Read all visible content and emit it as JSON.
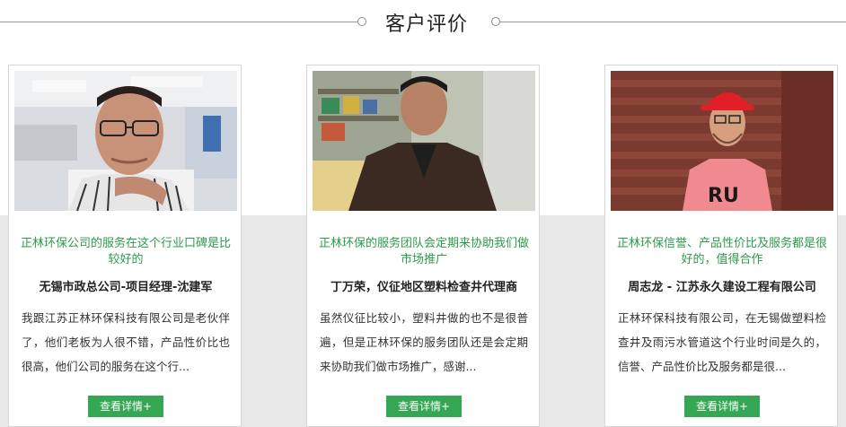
{
  "section": {
    "title": "客户评价"
  },
  "testimonials": [
    {
      "quote": "正林环保公司的服务在这个行业口碑是比较好的",
      "person": "无锡市政总公司-项目经理-沈建军",
      "body": "我跟江苏正林环保科技有限公司是老伙伴了，他们老板为人很不错，产品性价比也很高，他们公司的服务在这个行...",
      "button": "查看详情+",
      "photo": "portrait-man-glasses-office"
    },
    {
      "quote": "正林环保的服务团队会定期来协助我们做市场推广",
      "person": "丁万荣，仪征地区塑料检查井代理商",
      "body": "虽然仪征比较小，塑料井做的也不是很普遍，但是正林环保的服务团队还是会定期来协助我们做市场推广，感谢...",
      "button": "查看详情+",
      "photo": "portrait-man-leather-jacket"
    },
    {
      "quote": "正林环保信誉、产品性价比及服务都是很好的，值得合作",
      "person": "周志龙 - 江苏永久建设工程有限公司",
      "body": "正林环保科技有限公司，在无锡做塑料检查井及雨污水管道这个行业时间是久的，信誉、产品性价比及服务都是很...",
      "button": "查看详情+",
      "photo": "portrait-worker-red-helmet"
    }
  ],
  "colors": {
    "accent_green": "#35a754",
    "quote_green": "#2e9a4c",
    "band_grey": "#e8e8e8"
  }
}
